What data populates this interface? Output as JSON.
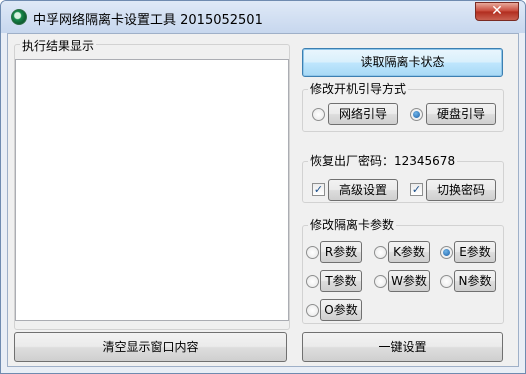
{
  "window": {
    "title": "中孚网络隔离卡设置工具  2015052501",
    "close_symbol": "✕"
  },
  "result_panel": {
    "legend": "执行结果显示",
    "content": ""
  },
  "read_status_button": "读取隔离卡状态",
  "boot_group": {
    "legend": "修改开机引导方式",
    "options": [
      {
        "label": "网络引导",
        "checked": false
      },
      {
        "label": "硬盘引导",
        "checked": true
      }
    ]
  },
  "restore_group": {
    "legend": "恢复出厂密码：12345678",
    "options": [
      {
        "label": "高级设置",
        "checked": true
      },
      {
        "label": "切换密码",
        "checked": true
      }
    ]
  },
  "param_group": {
    "legend": "修改隔离卡参数",
    "options": [
      {
        "label": "R参数",
        "checked": false
      },
      {
        "label": "K参数",
        "checked": false
      },
      {
        "label": "E参数",
        "checked": true
      },
      {
        "label": "T参数",
        "checked": false
      },
      {
        "label": "W参数",
        "checked": false
      },
      {
        "label": "N参数",
        "checked": false
      },
      {
        "label": "O参数",
        "checked": false
      }
    ]
  },
  "clear_button": "清空显示窗口内容",
  "oneclick_button": "一键设置",
  "colors": {
    "accent": "#3c7fb1",
    "close": "#c8493a",
    "title_bar": "#c7d7ee"
  }
}
